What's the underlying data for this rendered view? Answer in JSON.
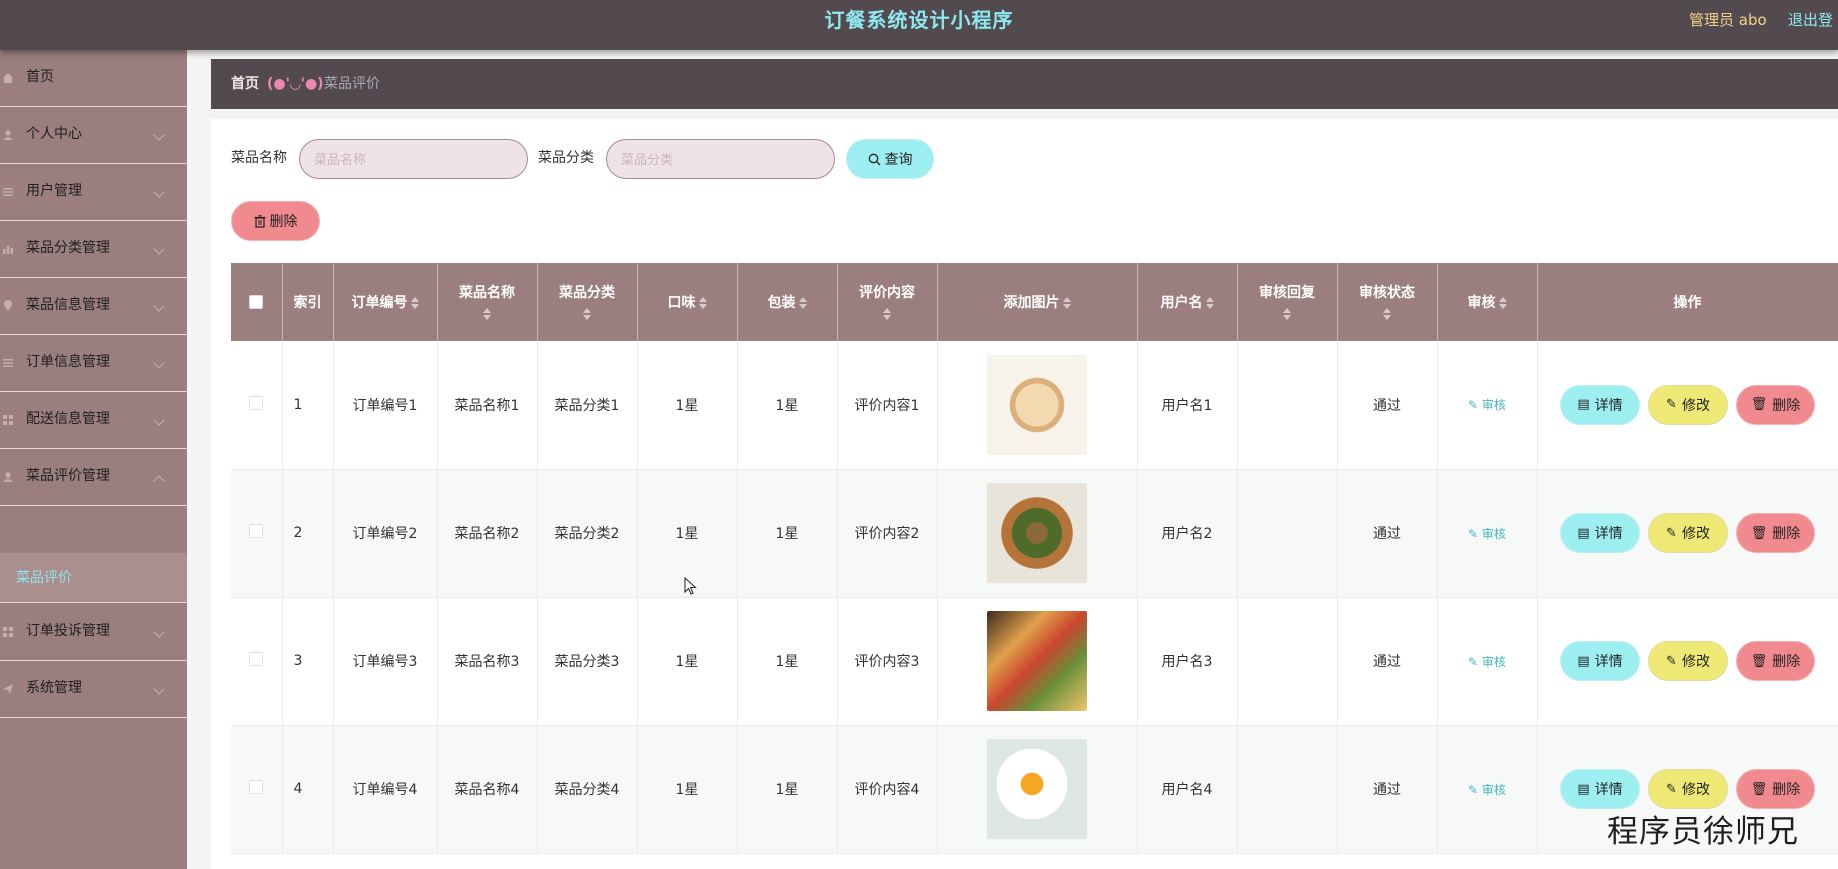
{
  "header": {
    "title": "订餐系统设计小程序",
    "admin_label": "管理员 abo",
    "logout_label": "退出登"
  },
  "sidebar": {
    "items": [
      {
        "label": "首页",
        "icon": "home-icon"
      },
      {
        "label": "个人中心",
        "icon": "user-icon"
      },
      {
        "label": "用户管理",
        "icon": "list-icon"
      },
      {
        "label": "菜品分类管理",
        "icon": "bar-chart-icon"
      },
      {
        "label": "菜品信息管理",
        "icon": "location-icon"
      },
      {
        "label": "订单信息管理",
        "icon": "list-icon"
      },
      {
        "label": "配送信息管理",
        "icon": "grid-icon"
      },
      {
        "label": "菜品评价管理",
        "icon": "user-icon"
      },
      {
        "label": "订单投诉管理",
        "icon": "grid-icon"
      },
      {
        "label": "系统管理",
        "icon": "send-icon"
      }
    ],
    "active_sub": "菜品评价"
  },
  "breadcrumb": {
    "home": "首页",
    "separator": "(●'◡'●)",
    "current": "菜品评价"
  },
  "search": {
    "name_label": "菜品名称",
    "name_placeholder": "菜品名称",
    "category_label": "菜品分类",
    "category_placeholder": "菜品分类",
    "query_label": "查询"
  },
  "toolbar": {
    "delete_label": "删除"
  },
  "table": {
    "headers": {
      "index": "索引",
      "order_no": "订单编号",
      "dish_name": "菜品名称",
      "dish_category": "菜品分类",
      "taste": "口味",
      "packaging": "包装",
      "review": "评价内容",
      "image": "添加图片",
      "username": "用户名",
      "reply": "审核回复",
      "status": "审核状态",
      "audit": "审核",
      "actions": "操作"
    },
    "rows": [
      {
        "index": "1",
        "order_no": "订单编号1",
        "dish_name": "菜品名称1",
        "dish_category": "菜品分类1",
        "taste": "1星",
        "packaging": "1星",
        "review": "评价内容1",
        "username": "用户名1",
        "reply": "",
        "status": "通过"
      },
      {
        "index": "2",
        "order_no": "订单编号2",
        "dish_name": "菜品名称2",
        "dish_category": "菜品分类2",
        "taste": "1星",
        "packaging": "1星",
        "review": "评价内容2",
        "username": "用户名2",
        "reply": "",
        "status": "通过"
      },
      {
        "index": "3",
        "order_no": "订单编号3",
        "dish_name": "菜品名称3",
        "dish_category": "菜品分类3",
        "taste": "1星",
        "packaging": "1星",
        "review": "评价内容3",
        "username": "用户名3",
        "reply": "",
        "status": "通过"
      },
      {
        "index": "4",
        "order_no": "订单编号4",
        "dish_name": "菜品名称4",
        "dish_category": "菜品分类4",
        "taste": "1星",
        "packaging": "1星",
        "review": "评价内容4",
        "username": "用户名4",
        "reply": "",
        "status": "通过"
      }
    ],
    "audit_link": "审核",
    "detail_label": "详情",
    "edit_label": "修改",
    "delete_label": "删除"
  },
  "watermark": "程序员徐师兄",
  "colors": {
    "topbar": "#534a4f",
    "sidebar": "#9b7f7f",
    "accent_cyan": "#9deef1",
    "accent_yellow": "#eee877",
    "accent_red": "#f08a8f"
  }
}
